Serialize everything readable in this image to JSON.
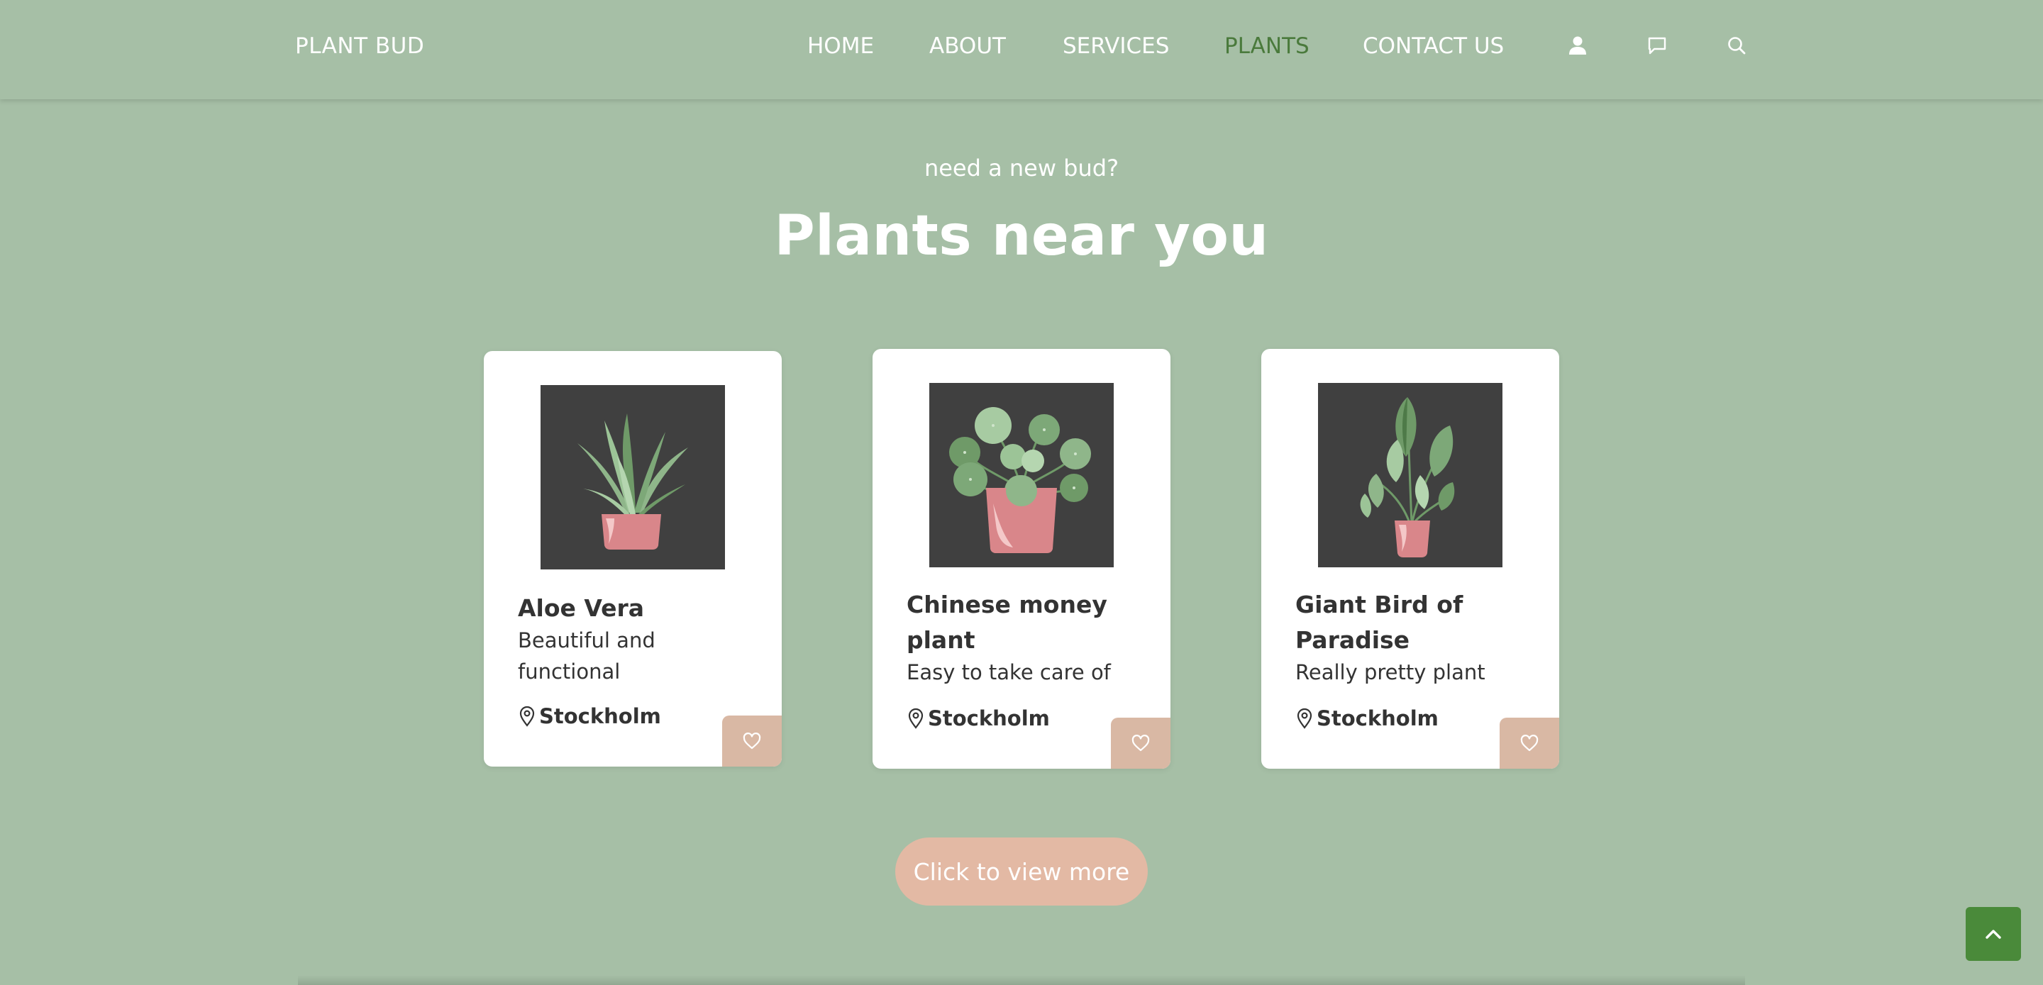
{
  "header": {
    "brand": "PLANT BUD",
    "nav": [
      {
        "label": "HOME"
      },
      {
        "label": "ABOUT"
      },
      {
        "label": "SERVICES"
      },
      {
        "label": "PLANTS",
        "active": true
      },
      {
        "label": "CONTACT US"
      }
    ],
    "icons": [
      "user-icon",
      "chat-icon",
      "search-icon"
    ]
  },
  "section": {
    "eyebrow": "need a new bud?",
    "title": "Plants near you"
  },
  "cards": [
    {
      "name": "Aloe Vera",
      "description": "Beautiful and functional",
      "location": "Stockholm",
      "image_icon": "aloe-vera-plant-illustration"
    },
    {
      "name": "Chinese money plant",
      "description": "Easy to take care of",
      "location": "Stockholm",
      "image_icon": "chinese-money-plant-illustration"
    },
    {
      "name": "Giant Bird of Paradise",
      "description": "Really pretty plant",
      "location": "Stockholm",
      "image_icon": "bird-of-paradise-plant-illustration"
    }
  ],
  "cta": {
    "label": "Click to view more"
  },
  "colors": {
    "background": "#a6bfa6",
    "active_nav": "#4a7a3c",
    "card": "#ffffff",
    "favorite_button": "#d9b8a4",
    "cta": "#e3b9a4",
    "to_top": "#4a8a3a",
    "image_bg": "#404040",
    "pot": "#d9868a"
  }
}
